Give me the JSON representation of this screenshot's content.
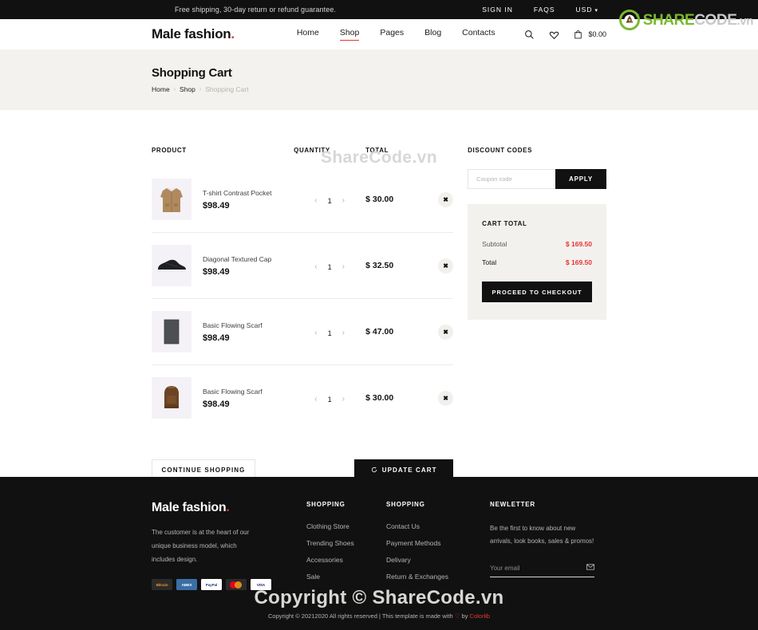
{
  "topbar": {
    "promo": "Free shipping, 30-day return or refund guarantee.",
    "sign_in": "SIGN IN",
    "faqs": "FAQS",
    "currency": "USD",
    "caret": "∨"
  },
  "header": {
    "logo": "Male fashion",
    "logo_dot": ".",
    "nav": [
      {
        "label": "Home",
        "active": false
      },
      {
        "label": "Shop",
        "active": true
      },
      {
        "label": "Pages",
        "active": false
      },
      {
        "label": "Blog",
        "active": false
      },
      {
        "label": "Contacts",
        "active": false
      }
    ],
    "search_icon": "search-icon",
    "wishlist_icon": "heart-icon",
    "cart_icon": "cart-icon",
    "cart_amount": "$0.00"
  },
  "breadcrumb": {
    "title": "Shopping Cart",
    "items": [
      {
        "label": "Home",
        "current": false
      },
      {
        "label": "Shop",
        "current": false
      },
      {
        "label": "Shopping Cart",
        "current": true
      }
    ],
    "separator": "›"
  },
  "cart": {
    "columns": {
      "product": "PRODUCT",
      "quantity": "QUANTITY",
      "total": "TOTAL"
    },
    "items": [
      {
        "name": "T-shirt Contrast Pocket",
        "price": "$98.49",
        "qty": "1",
        "total": "$ 30.00",
        "thumb": "jacket"
      },
      {
        "name": "Diagonal Textured Cap",
        "price": "$98.49",
        "qty": "1",
        "total": "$ 32.50",
        "thumb": "sneaker"
      },
      {
        "name": "Basic Flowing Scarf",
        "price": "$98.49",
        "qty": "1",
        "total": "$ 47.00",
        "thumb": "scarf"
      },
      {
        "name": "Basic Flowing Scarf",
        "price": "$98.49",
        "qty": "1",
        "total": "$ 30.00",
        "thumb": "backpack"
      }
    ],
    "qty_prev": "‹",
    "qty_next": "›",
    "remove_label": "✖",
    "continue_shopping": "CONTINUE SHOPPING",
    "update_cart": "UPDATE CART",
    "update_icon": "refresh-icon"
  },
  "discount": {
    "title": "DISCOUNT CODES",
    "placeholder": "Coupon code",
    "value": "",
    "apply": "APPLY"
  },
  "cart_total": {
    "title": "CART TOTAL",
    "rows": [
      {
        "label": "Subtotal",
        "value": "$ 169.50"
      },
      {
        "label": "Total",
        "value": "$ 169.50"
      }
    ],
    "checkout": "PROCEED TO CHECKOUT"
  },
  "footer": {
    "logo": "Male fashion",
    "logo_dot": ".",
    "description": "The customer is at the heart of our unique business model, which includes design.",
    "payments": [
      "Bitcoin",
      "AMEX",
      "PayPal",
      "MasterCard",
      "VISA"
    ],
    "col1": {
      "heading": "SHOPPING",
      "links": [
        "Clothing Store",
        "Trending Shoes",
        "Accessories",
        "Sale"
      ]
    },
    "col2": {
      "heading": "SHOPPING",
      "links": [
        "Contact Us",
        "Payment Methods",
        "Delivary",
        "Return & Exchanges"
      ]
    },
    "newsletter": {
      "heading": "NEWLETTER",
      "description": "Be the first to know about new arrivals, look books, sales & promos!",
      "placeholder": "Your email",
      "value": "",
      "submit_icon": "envelope-icon"
    },
    "copyright_pre": "Copyright © 20212020 All rights reserved | This template is made with ",
    "copyright_heart": "♡",
    "copyright_by": " by ",
    "copyright_brand": "Colorlib"
  },
  "watermark": {
    "middle": "ShareCode.vn",
    "bottom": "Copyright © ShareCode.vn",
    "logo_share": "SHARE",
    "logo_code": "CODE",
    "logo_vn": ".vn"
  }
}
